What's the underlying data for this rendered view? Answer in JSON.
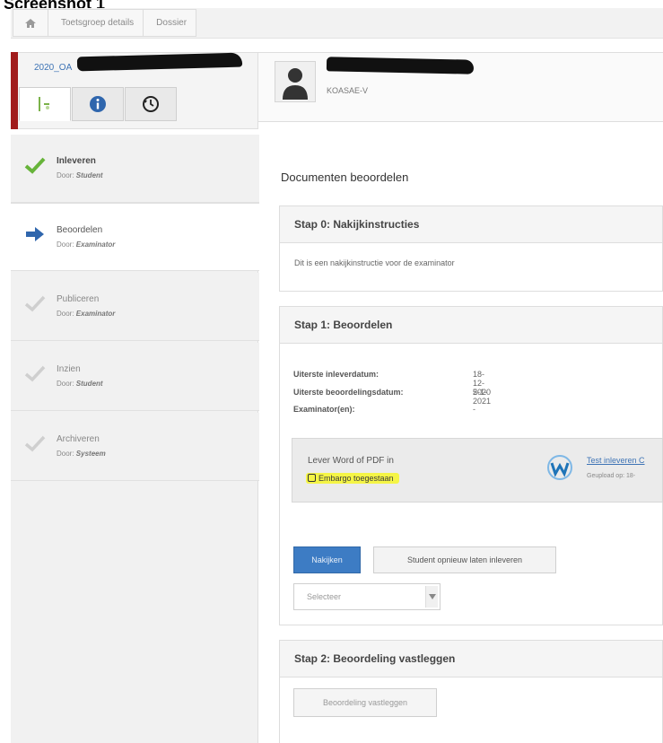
{
  "caption": "Screenshot 1",
  "breadcrumb": {
    "items": [
      "Toetsgroep details",
      "Dossier"
    ]
  },
  "dossier": {
    "id": "2020_OA"
  },
  "person": {
    "code": "KOASAE-V"
  },
  "steps": [
    {
      "title": "Inleveren",
      "by_prefix": "Door:",
      "by": "Student",
      "state": "done"
    },
    {
      "title": "Beoordelen",
      "by_prefix": "Door:",
      "by": "Examinator",
      "state": "active"
    },
    {
      "title": "Publiceren",
      "by_prefix": "Door:",
      "by": "Examinator",
      "state": "pending"
    },
    {
      "title": "Inzien",
      "by_prefix": "Door:",
      "by": "Student",
      "state": "pending"
    },
    {
      "title": "Archiveren",
      "by_prefix": "Door:",
      "by": "Systeem",
      "state": "pending"
    }
  ],
  "main": {
    "title": "Documenten beoordelen",
    "stap0": {
      "title": "Stap 0: Nakijkinstructies",
      "text": "Dit is een nakijkinstructie voor de examinator"
    },
    "stap1": {
      "title": "Stap 1: Beoordelen",
      "rows": [
        {
          "label": "Uiterste inleverdatum:",
          "value": "18-12-2020"
        },
        {
          "label": "Uiterste beoordelingsdatum:",
          "value": "5-1-2021"
        },
        {
          "label": "Examinator(en):",
          "value": "-"
        }
      ],
      "upload_label": "Lever Word of PDF in",
      "embargo": "Embargo toegestaan",
      "file_link": "Test inleveren C",
      "file_sub": "Geupload op: 18-",
      "btn_nakijken": "Nakijken",
      "btn_opnieuw": "Student opnieuw laten inleveren",
      "select_value": "Selecteer"
    },
    "stap2": {
      "title": "Stap 2:  Beoordeling vastleggen",
      "btn": "Beoordeling vastleggen"
    }
  }
}
